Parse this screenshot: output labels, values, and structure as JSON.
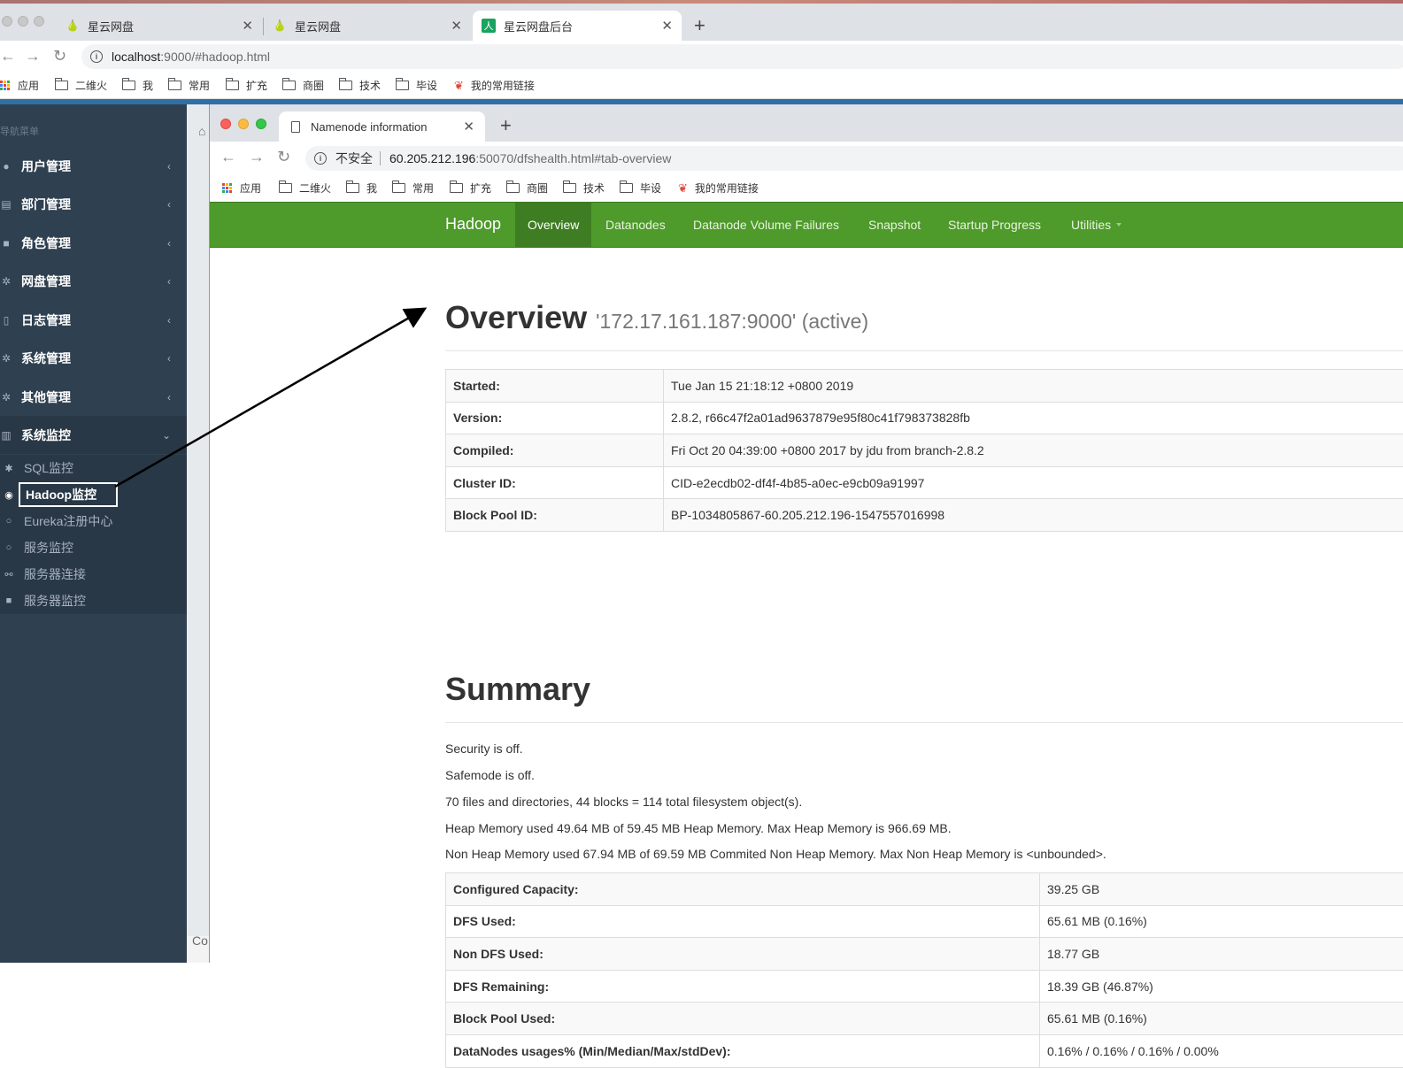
{
  "outer_browser": {
    "tabs": [
      {
        "title": "星云网盘",
        "icon": "pear-icon"
      },
      {
        "title": "星云网盘",
        "icon": "pear-icon"
      },
      {
        "title": "星云网盘后台",
        "icon": "green-app-icon"
      }
    ],
    "url_host": "localhost",
    "url_rest": ":9000/#hadoop.html",
    "bookmarks": {
      "apps": "应用",
      "folders": [
        "二维火",
        "我",
        "常用",
        "扩充",
        "商圈",
        "技术",
        "毕设"
      ],
      "links": "我的常用链接"
    }
  },
  "sidebar": {
    "nav_title": "导航菜单",
    "items": [
      {
        "label": "用户管理",
        "icon": "user-icon"
      },
      {
        "label": "部门管理",
        "icon": "id-card-icon"
      },
      {
        "label": "角色管理",
        "icon": "lock-icon"
      },
      {
        "label": "网盘管理",
        "icon": "gear-icon"
      },
      {
        "label": "日志管理",
        "icon": "file-icon"
      },
      {
        "label": "系统管理",
        "icon": "gear-icon"
      },
      {
        "label": "其他管理",
        "icon": "gear-icon"
      },
      {
        "label": "系统监控",
        "icon": "bar-chart-icon"
      }
    ],
    "submenu": [
      {
        "label": "SQL监控",
        "icon": "bug-icon"
      },
      {
        "label": "Hadoop监控",
        "icon": "eye-icon"
      },
      {
        "label": "Eureka注册中心",
        "icon": "circle-icon"
      },
      {
        "label": "服务监控",
        "icon": "circle-icon"
      },
      {
        "label": "服务器连接",
        "icon": "link-icon"
      },
      {
        "label": "服务器监控",
        "icon": "video-icon"
      }
    ],
    "footer_text": "Co"
  },
  "inner_browser": {
    "tab_title": "Namenode information",
    "insecure_label": "不安全",
    "url_host": "60.205.212.196",
    "url_rest": ":50070/dfshealth.html#tab-overview",
    "bookmarks": {
      "apps": "应用",
      "folders": [
        "二维火",
        "我",
        "常用",
        "扩充",
        "商圈",
        "技术",
        "毕设"
      ],
      "links": "我的常用链接"
    }
  },
  "hadoop": {
    "brand": "Hadoop",
    "nav": [
      "Overview",
      "Datanodes",
      "Datanode Volume Failures",
      "Snapshot",
      "Startup Progress",
      "Utilities"
    ],
    "overview_title": "Overview",
    "overview_sub": "'172.17.161.187:9000' (active)",
    "overview_rows": [
      [
        "Started:",
        "Tue Jan 15 21:18:12 +0800 2019"
      ],
      [
        "Version:",
        "2.8.2, r66c47f2a01ad9637879e95f80c41f798373828fb"
      ],
      [
        "Compiled:",
        "Fri Oct 20 04:39:00 +0800 2017 by jdu from branch-2.8.2"
      ],
      [
        "Cluster ID:",
        "CID-e2ecdb02-df4f-4b85-a0ec-e9cb09a91997"
      ],
      [
        "Block Pool ID:",
        "BP-1034805867-60.205.212.196-1547557016998"
      ]
    ],
    "summary_title": "Summary",
    "summary_lines": [
      "Security is off.",
      "Safemode is off.",
      "70 files and directories, 44 blocks = 114 total filesystem object(s).",
      "Heap Memory used 49.64 MB of 59.45 MB Heap Memory. Max Heap Memory is 966.69 MB.",
      "Non Heap Memory used 67.94 MB of 69.59 MB Commited Non Heap Memory. Max Non Heap Memory is <unbounded>."
    ],
    "summary_rows": [
      [
        "Configured Capacity:",
        "39.25 GB"
      ],
      [
        "DFS Used:",
        "65.61 MB (0.16%)"
      ],
      [
        "Non DFS Used:",
        "18.77 GB"
      ],
      [
        "DFS Remaining:",
        "18.39 GB (46.87%)"
      ],
      [
        "Block Pool Used:",
        "65.61 MB (0.16%)"
      ],
      [
        "DataNodes usages% (Min/Median/Max/stdDev):",
        "0.16% / 0.16% / 0.16% / 0.00%"
      ]
    ]
  },
  "colors": {
    "hadoop_green": "#4e9a2b",
    "sidebar_bg": "#2f4050",
    "app_blue": "#2f6fa6"
  }
}
